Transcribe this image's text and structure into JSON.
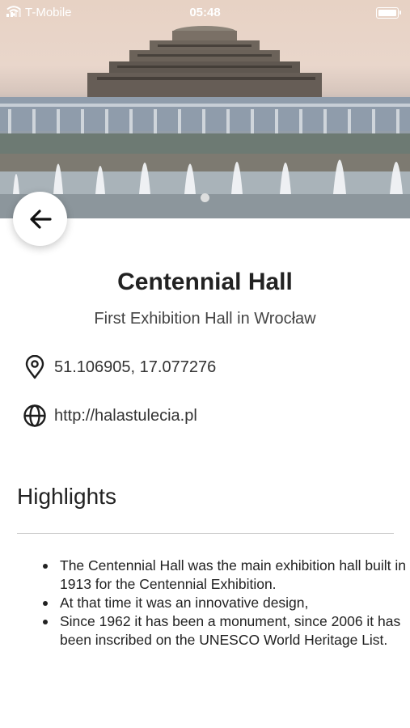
{
  "status_bar": {
    "carrier": "T-Mobile",
    "time": "05:48"
  },
  "hero": {
    "image_description_icon": "centennial-hall-photo",
    "carousel_page": 1
  },
  "header": {
    "back_icon": "arrow-left-icon"
  },
  "place": {
    "title": "Centennial Hall",
    "subtitle": "First Exhibition Hall in Wrocław",
    "coordinates": "51.106905, 17.077276",
    "website": "http://halastulecia.pl",
    "location_icon": "map-pin-icon",
    "website_icon": "globe-icon"
  },
  "highlights": {
    "heading": "Highlights",
    "items": [
      "The Centennial Hall was the main exhibition hall built in 1913 for the Centennial Exhibition.",
      "At that time it was an innovative design,",
      "Since 1962 it has been a monument, since 2006 it has been inscribed on the UNESCO World Heritage List."
    ]
  }
}
